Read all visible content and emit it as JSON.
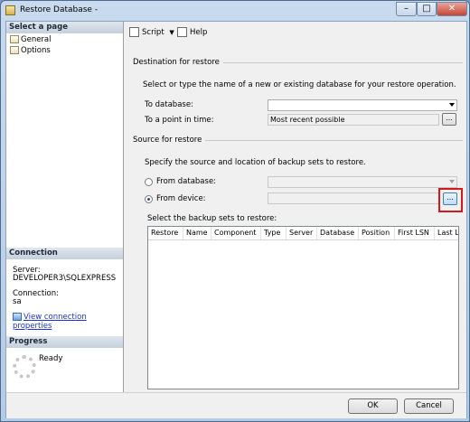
{
  "window": {
    "title": "Restore Database -",
    "minimize_glyph": "–",
    "maximize_glyph": "□",
    "close_glyph": "✕"
  },
  "left_pane": {
    "select_page_header": "Select a page",
    "pages": [
      {
        "label": "General",
        "icon": "page-icon"
      },
      {
        "label": "Options",
        "icon": "page-icon"
      }
    ],
    "connection_header": "Connection",
    "server_label": "Server:",
    "server_value": "DEVELOPER3\\SQLEXPRESS",
    "connection_label": "Connection:",
    "connection_value": "sa",
    "view_connection_link": "View connection properties",
    "progress_header": "Progress",
    "progress_status": "Ready"
  },
  "toolbar": {
    "script_label": "Script",
    "help_label": "Help"
  },
  "destination": {
    "group_title": "Destination for restore",
    "instruction": "Select or type the name of a new or existing database for your restore operation.",
    "to_database_label": "To database:",
    "to_database_value": "",
    "point_in_time_label": "To a point in time:",
    "point_in_time_value": "Most recent possible",
    "ellipsis": "..."
  },
  "source": {
    "group_title": "Source for restore",
    "instruction": "Specify the source and location of backup sets to restore.",
    "from_database_label": "From database:",
    "from_database_value": "",
    "from_device_label": "From device:",
    "from_device_value": "",
    "selected_option": "From device",
    "ellipsis": "...",
    "backup_sets_label": "Select the backup sets to restore:",
    "columns": [
      "Restore",
      "Name",
      "Component",
      "Type",
      "Server",
      "Database",
      "Position",
      "First LSN",
      "Last LS"
    ]
  },
  "footer": {
    "ok_label": "OK",
    "cancel_label": "Cancel"
  },
  "colors": {
    "highlight": "#d21a1a",
    "link": "#1a33cc"
  }
}
